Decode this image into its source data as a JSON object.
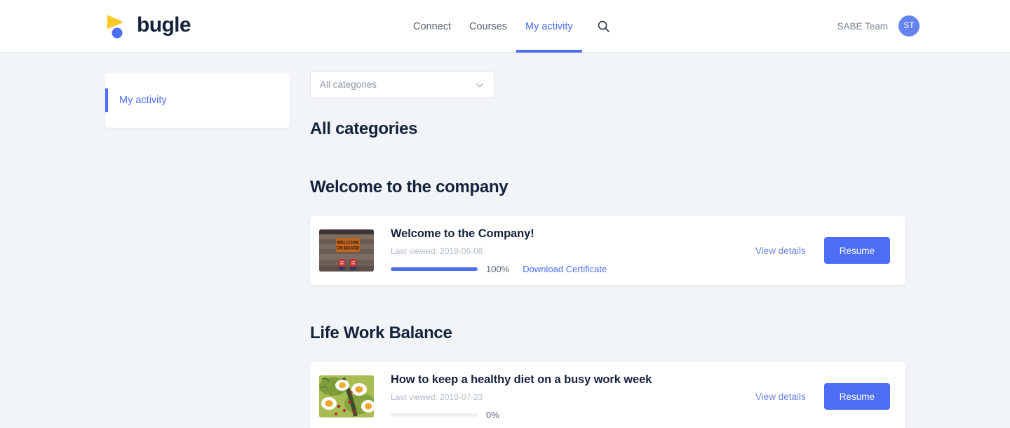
{
  "header": {
    "brand_word": "bugle",
    "nav": [
      {
        "label": "Connect",
        "active": false
      },
      {
        "label": "Courses",
        "active": false
      },
      {
        "label": "My activity",
        "active": true
      }
    ],
    "search_icon": "search-icon",
    "user": {
      "name": "SABE Team",
      "avatar_initials": "ST"
    }
  },
  "sidebar": {
    "items": [
      {
        "label": "My activity",
        "active": true
      }
    ]
  },
  "main": {
    "filter": {
      "selected": "All categories",
      "chevron_icon": "chevron-down-icon"
    },
    "page_title": "All categories",
    "categories": [
      {
        "title": "Welcome to the company",
        "courses": [
          {
            "title": "Welcome to the Company!",
            "last_viewed": "Last viewed: 2018-06-08",
            "progress": 100,
            "progress_label": "100%",
            "certificate_link": "Download Certificate",
            "view_details": "View details",
            "action_label": "Resume",
            "thumbnail": "welcome-on-board-doormat"
          }
        ]
      },
      {
        "title": "Life Work Balance",
        "courses": [
          {
            "title": "How to keep a healthy diet on a busy work week",
            "last_viewed": "Last viewed: 2018-07-23",
            "progress": 0,
            "progress_label": "0%",
            "certificate_link": null,
            "view_details": "View details",
            "action_label": "Resume",
            "thumbnail": "avocado-toast-eggs"
          }
        ]
      }
    ]
  },
  "colors": {
    "accent": "#4c6ef5",
    "page_background": "#f1f5f7",
    "heading": "#15223b",
    "muted_text": "#b3bcc6",
    "logo_yellow": "#ffc928",
    "logo_red": "#ef4a47",
    "logo_blue": "#4c6ef5"
  }
}
